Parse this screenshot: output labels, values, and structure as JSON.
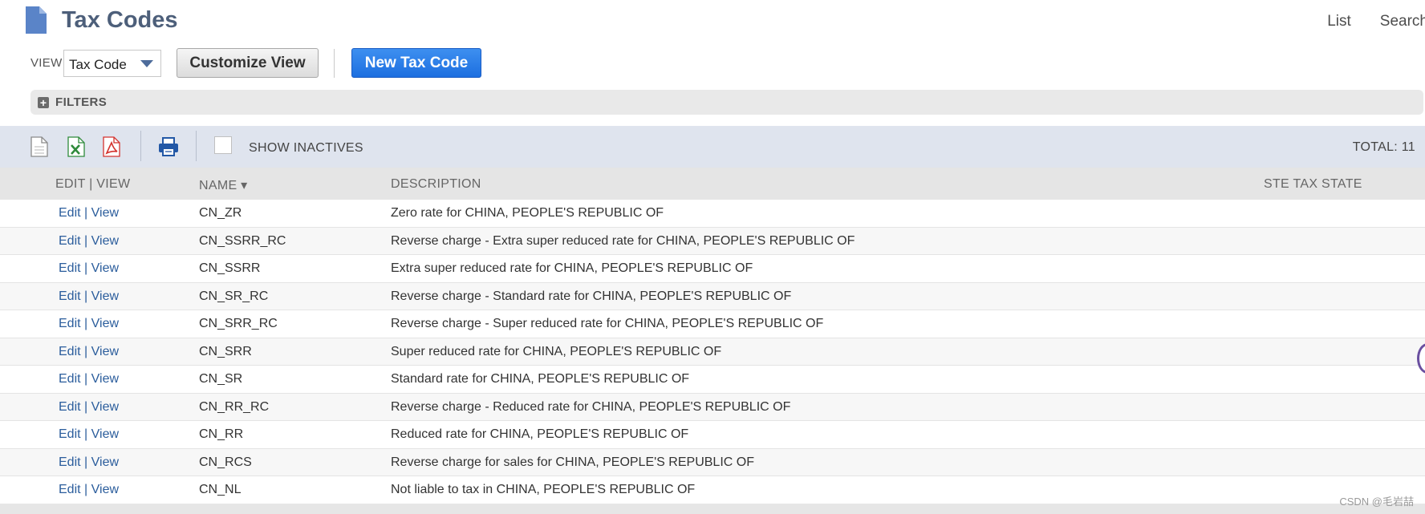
{
  "header": {
    "title": "Tax Codes",
    "links": [
      "List",
      "Search"
    ]
  },
  "controls": {
    "view_label": "VIEW",
    "view_value": "Tax Code",
    "customize_label": "Customize View",
    "new_label": "New Tax Code"
  },
  "filters": {
    "label": "FILTERS"
  },
  "toolbar": {
    "show_inactives_label": "SHOW INACTIVES",
    "show_inactives_checked": false,
    "total_label": "TOTAL: 11"
  },
  "table": {
    "columns": {
      "edit_view": "EDIT | VIEW",
      "name": "NAME ▾",
      "description": "DESCRIPTION",
      "ste_tax_state": "STE TAX STATE"
    },
    "edit_label": "Edit",
    "separator": "|",
    "view_label": "View",
    "rows": [
      {
        "name": "CN_ZR",
        "description": "Zero rate for CHINA, PEOPLE'S REPUBLIC OF"
      },
      {
        "name": "CN_SSRR_RC",
        "description": "Reverse charge - Extra super reduced rate for CHINA, PEOPLE'S REPUBLIC OF"
      },
      {
        "name": "CN_SSRR",
        "description": "Extra super reduced rate for CHINA, PEOPLE'S REPUBLIC OF"
      },
      {
        "name": "CN_SR_RC",
        "description": "Reverse charge - Standard rate for CHINA, PEOPLE'S REPUBLIC OF"
      },
      {
        "name": "CN_SRR_RC",
        "description": "Reverse charge - Super reduced rate for CHINA, PEOPLE'S REPUBLIC OF"
      },
      {
        "name": "CN_SRR",
        "description": "Super reduced rate for CHINA, PEOPLE'S REPUBLIC OF"
      },
      {
        "name": "CN_SR",
        "description": "Standard rate for CHINA, PEOPLE'S REPUBLIC OF"
      },
      {
        "name": "CN_RR_RC",
        "description": "Reverse charge - Reduced rate for CHINA, PEOPLE'S REPUBLIC OF"
      },
      {
        "name": "CN_RR",
        "description": "Reduced rate for CHINA, PEOPLE'S REPUBLIC OF"
      },
      {
        "name": "CN_RCS",
        "description": "Reverse charge for sales for CHINA, PEOPLE'S REPUBLIC OF"
      },
      {
        "name": "CN_NL",
        "description": "Not liable to tax in CHINA, PEOPLE'S REPUBLIC OF"
      }
    ]
  },
  "watermark": "CSDN @毛岩喆",
  "icons": {
    "title": "document-icon",
    "export_csv": "csv-export-icon",
    "export_excel": "excel-export-icon",
    "export_pdf": "pdf-export-icon",
    "print": "print-icon",
    "filters_expand": "plus-icon"
  },
  "colors": {
    "title": "#4d5f7a",
    "primary_button": "#2a7de9",
    "link": "#2b5d9c",
    "toolbar_bg": "#dfe4ee"
  }
}
